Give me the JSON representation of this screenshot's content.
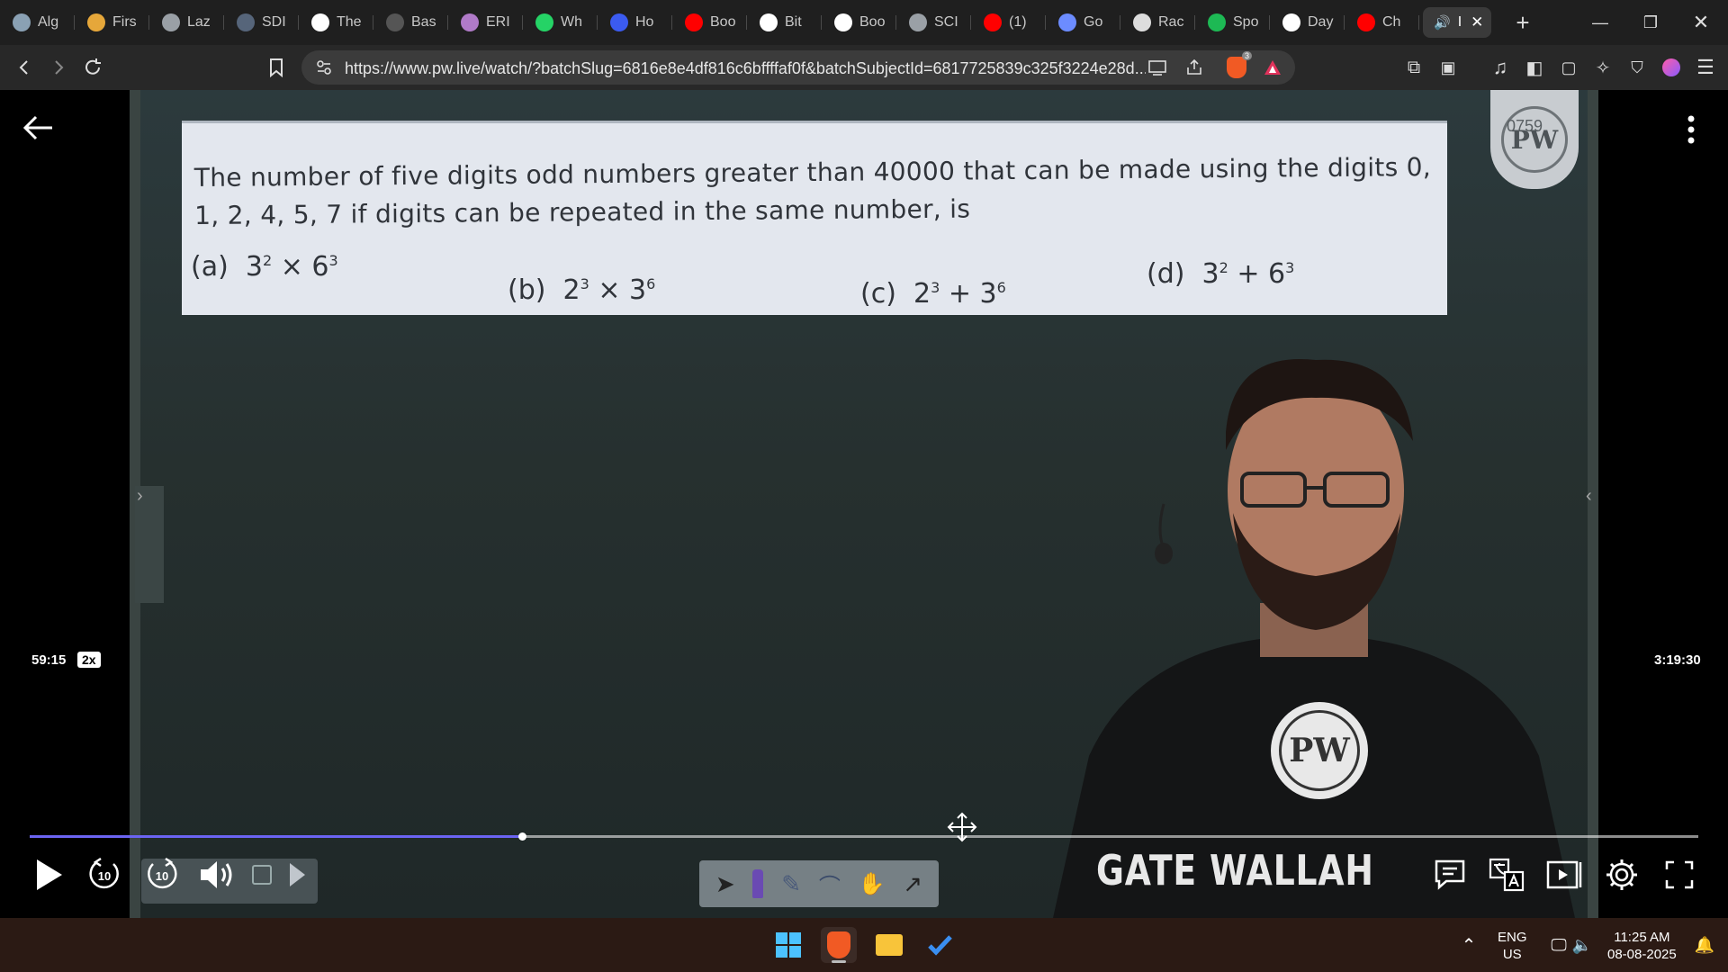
{
  "browser": {
    "tabs": [
      {
        "label": "Alg",
        "icon": "globe-icon",
        "color": "#8aa1b4"
      },
      {
        "label": "Firs",
        "icon": "lightning-icon",
        "color": "#e6a73a"
      },
      {
        "label": "Laz",
        "icon": "globe-icon",
        "color": "#9aa0a6"
      },
      {
        "label": "SDI",
        "icon": "doc-icon",
        "color": "#56657a"
      },
      {
        "label": "The",
        "icon": "w3-icon",
        "color": "#ffffff"
      },
      {
        "label": "Bas",
        "icon": "doc-icon",
        "color": "#555555"
      },
      {
        "label": "ERI",
        "icon": "brain-icon",
        "color": "#b07ac8"
      },
      {
        "label": "Wh",
        "icon": "whatsapp-icon",
        "color": "#25d366"
      },
      {
        "label": "Ho",
        "icon": "bookmark-icon",
        "color": "#3b5bf0"
      },
      {
        "label": "Boo",
        "icon": "youtube-icon",
        "color": "#ff0000"
      },
      {
        "label": "Bit",
        "icon": "bit-icon",
        "color": "#ffffff"
      },
      {
        "label": "Boo",
        "icon": "google-icon",
        "color": "#ffffff"
      },
      {
        "label": "SCI",
        "icon": "globe-icon",
        "color": "#9aa0a6"
      },
      {
        "label": "(1)",
        "icon": "youtube-icon",
        "color": "#ff0000"
      },
      {
        "label": "Go",
        "icon": "gemini-icon",
        "color": "#6c8cff"
      },
      {
        "label": "Rac",
        "icon": "openai-icon",
        "color": "#dddddd"
      },
      {
        "label": "Spo",
        "icon": "spotify-icon",
        "color": "#1db954"
      },
      {
        "label": "Day",
        "icon": "wikipedia-icon",
        "color": "#ffffff"
      },
      {
        "label": "Ch",
        "icon": "youtube-icon",
        "color": "#ff0000"
      }
    ],
    "active_tab": {
      "label": "I",
      "icon": "speaker-icon"
    },
    "url": "https://www.pw.live/watch/?batchSlug=6816e8e4df816c6bffffaf0f&batchSubjectId=6817725839c325f3224e28d...",
    "brave_badge": "3"
  },
  "video": {
    "question": "The number of five digits odd numbers greater than 40000 that can be made using the digits 0, 1, 2, 4, 5, 7 if digits can be repeated in the same number, is",
    "options": [
      {
        "label": "(a)",
        "base1": "3",
        "exp1": "2",
        "op": "×",
        "base2": "6",
        "exp2": "3"
      },
      {
        "label": "(b)",
        "base1": "2",
        "exp1": "3",
        "op": "×",
        "base2": "3",
        "exp2": "6"
      },
      {
        "label": "(c)",
        "base1": "2",
        "exp1": "3",
        "op": "+",
        "base2": "3",
        "exp2": "6"
      },
      {
        "label": "(d)",
        "base1": "3",
        "exp1": "2",
        "op": "+",
        "base2": "6",
        "exp2": "3"
      }
    ],
    "seal_text": "PW",
    "seal_number": "0759",
    "shirt_logo": "PW",
    "channel_text": "GATE WALLAH",
    "time_current": "59:15",
    "speed": "2x",
    "time_total": "3:19:30",
    "progress_fraction": 0.295,
    "seek_back": "10",
    "seek_forward": "10"
  },
  "taskbar": {
    "lang_top": "ENG",
    "lang_bottom": "US",
    "time": "11:25 AM",
    "date": "08-08-2025"
  },
  "colors": {
    "accent": "#6b64f2",
    "tab_bg": "#1f1f1f",
    "toolbar_bg": "#282828",
    "taskbar_bg": "#2b1a14"
  }
}
